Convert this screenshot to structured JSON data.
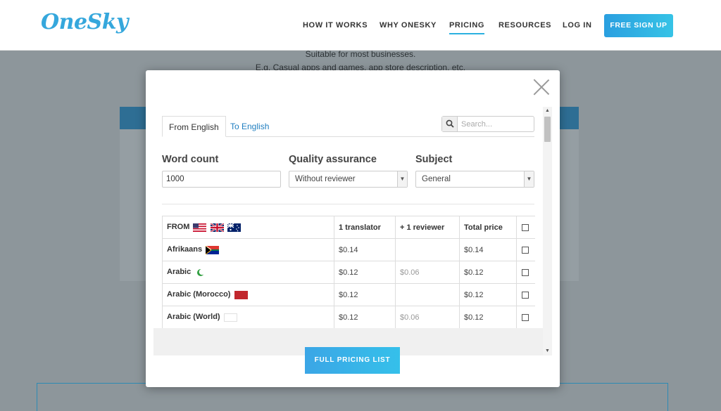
{
  "header": {
    "logo": "OneSky",
    "nav": [
      {
        "label": "HOW IT WORKS"
      },
      {
        "label": "WHY ONESKY"
      },
      {
        "label": "PRICING"
      },
      {
        "label": "RESOURCES"
      },
      {
        "label": "LOG IN"
      }
    ],
    "signup": "FREE SIGN UP"
  },
  "background": {
    "line1": "Suitable for most businesses.",
    "line2": "E.g. Casual apps and games, app store description, etc."
  },
  "modal": {
    "tabs": [
      {
        "label": "From English"
      },
      {
        "label": "To English"
      }
    ],
    "search_placeholder": "Search...",
    "word_count_label": "Word count",
    "word_count_value": "1000",
    "quality_label": "Quality assurance",
    "quality_value": "Without reviewer",
    "subject_label": "Subject",
    "subject_value": "General",
    "table": {
      "headers": {
        "from": "FROM",
        "translator": "1 translator",
        "reviewer": "+ 1 reviewer",
        "total": "Total price"
      },
      "rows": [
        {
          "lang": "Afrikaans",
          "translator": "$0.14",
          "reviewer": "",
          "total": "$0.14"
        },
        {
          "lang": "Arabic",
          "translator": "$0.12",
          "reviewer": "$0.06",
          "total": "$0.12"
        },
        {
          "lang": "Arabic (Morocco)",
          "translator": "$0.12",
          "reviewer": "",
          "total": "$0.12"
        },
        {
          "lang": "Arabic (World)",
          "translator": "$0.12",
          "reviewer": "$0.06",
          "total": "$0.12"
        }
      ]
    },
    "full_pricing_button": "FULL PRICING LIST"
  }
}
